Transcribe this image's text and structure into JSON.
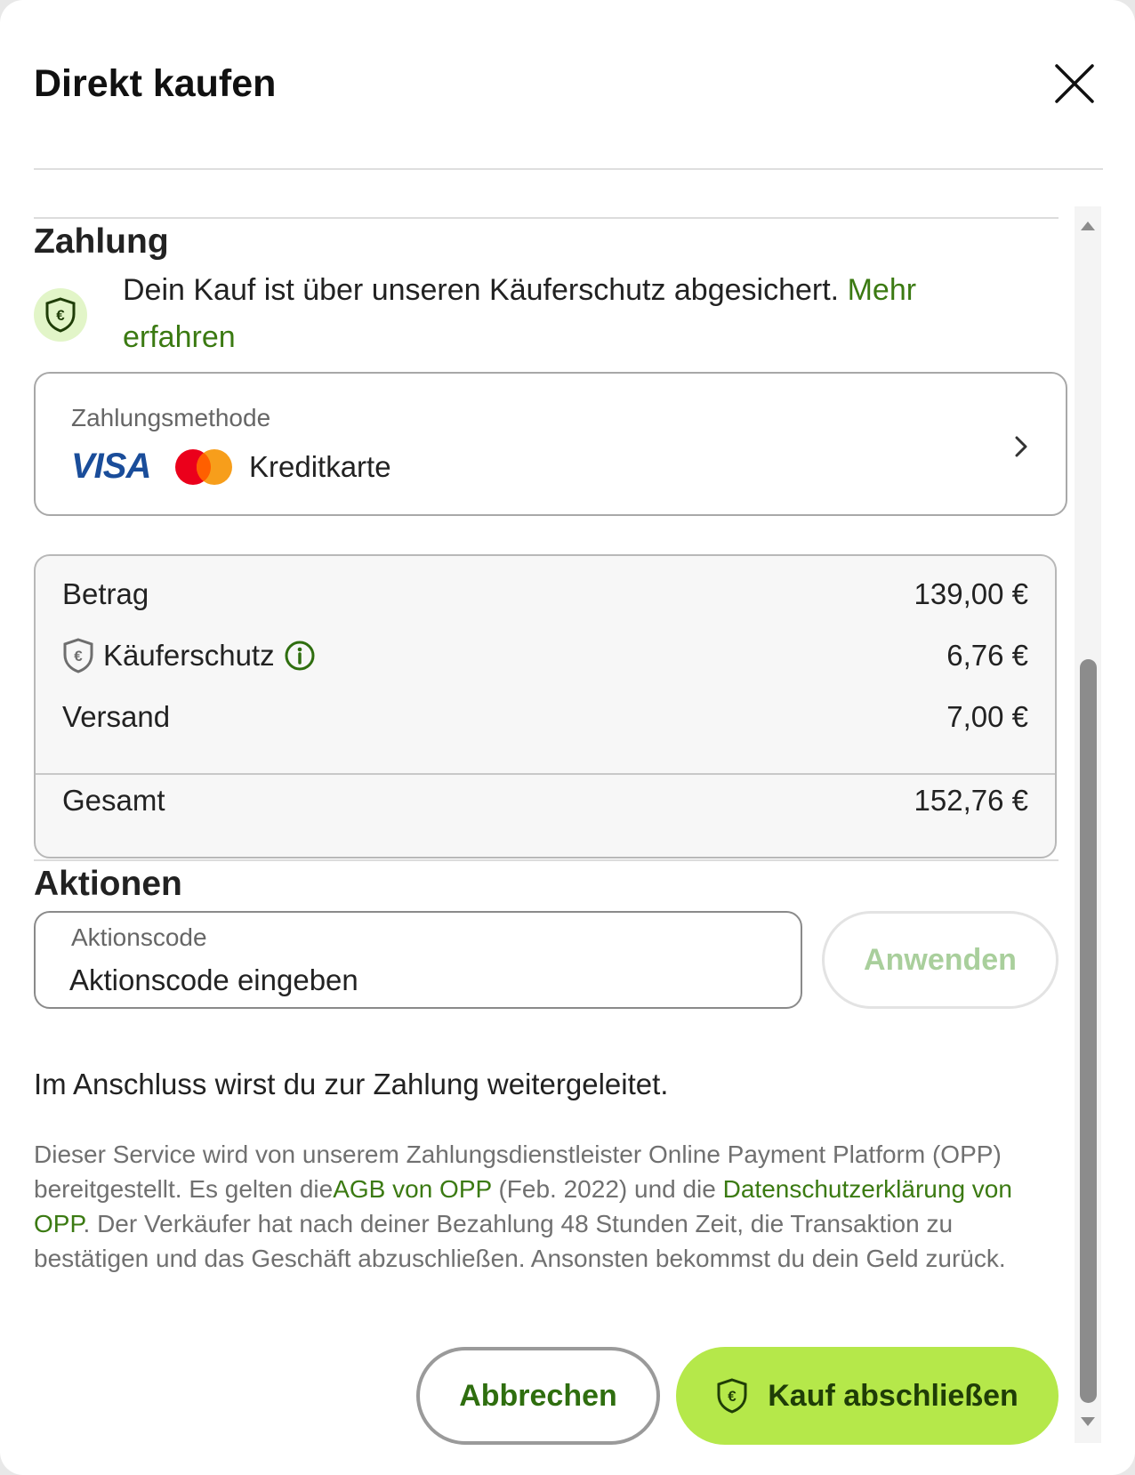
{
  "header": {
    "title": "Direkt kaufen",
    "close_icon": "close-icon"
  },
  "payment": {
    "section_title": "Zahlung",
    "protection_text": "Dein Kauf ist über unseren Käuferschutz abgesichert.",
    "protection_link": "Mehr erfahren",
    "method_label": "Zahlungsmethode",
    "visa_logo": "VISA",
    "method_value": "Kreditkarte"
  },
  "summary": {
    "rows": [
      {
        "label": "Betrag",
        "value": "139,00 €"
      },
      {
        "label": "Käuferschutz",
        "value": "6,76 €"
      },
      {
        "label": "Versand",
        "value": "7,00 €"
      }
    ],
    "total_label": "Gesamt",
    "total_value": "152,76 €"
  },
  "actions": {
    "section_title": "Aktionen",
    "promo_label": "Aktionscode",
    "promo_placeholder": "Aktionscode eingeben",
    "apply_label": "Anwenden"
  },
  "footer": {
    "redirect_text": "Im Anschluss wirst du zur Zahlung weitergeleitet.",
    "legal_part1": "Dieser Service wird von unserem Zahlungsdienstleister Online Payment Platform (OPP) bereitgestellt. Es gelten die",
    "legal_link1": "AGB von OPP",
    "legal_part2": " (Feb. 2022) und die ",
    "legal_link2": "Datenschutzerklärung von OPP",
    "legal_part3": ". Der Verkäufer hat nach deiner Bezahlung 48 Stunden Zeit, die Transaktion zu bestätigen und das Geschäft abzuschließen. Ansonsten bekommst du dein Geld zurück.",
    "cancel_label": "Abbrechen",
    "buy_label": "Kauf abschließen"
  },
  "colors": {
    "accent_green": "#3b7a12",
    "buy_button": "#b5e84a",
    "protect_bg": "#e2f5c8"
  }
}
